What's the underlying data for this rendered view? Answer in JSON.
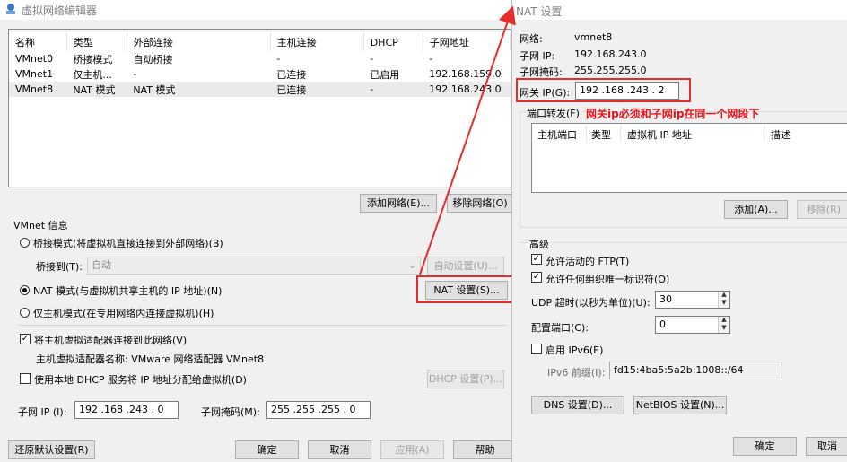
{
  "left_window": {
    "title": "虚拟网络编辑器",
    "table": {
      "columns": [
        "名称",
        "类型",
        "外部连接",
        "主机连接",
        "DHCP",
        "子网地址"
      ],
      "rows": [
        [
          "VMnet0",
          "桥接模式",
          "自动桥接",
          "-",
          "-",
          "-"
        ],
        [
          "VMnet1",
          "仅主机...",
          "-",
          "已连接",
          "已启用",
          "192.168.159.0"
        ],
        [
          "VMnet8",
          "NAT 模式",
          "NAT 模式",
          "已连接",
          "-",
          "192.168.243.0"
        ]
      ]
    },
    "add_network": "添加网络(E)...",
    "remove_network": "移除网络(O)",
    "vmnet_info": "VMnet 信息",
    "bridge_mode": "桥接模式(将虚拟机直接连接到外部网络)(B)",
    "bridge_to_label": "桥接到(T):",
    "bridge_to_value": "自动",
    "auto_settings": "自动设置(U)...",
    "nat_mode": "NAT 模式(与虚拟机共享主机的 IP 地址)(N)",
    "nat_settings": "NAT 设置(S)...",
    "host_only": "仅主机模式(在专用网络内连接虚拟机)(H)",
    "connect_adapter": "将主机虚拟适配器连接到此网络(V)",
    "adapter_name": "主机虚拟适配器名称: VMware 网络适配器 VMnet8",
    "use_dhcp": "使用本地 DHCP 服务将 IP 地址分配给虚拟机(D)",
    "dhcp_settings": "DHCP 设置(P)...",
    "subnet_ip_label": "子网 IP (I):",
    "subnet_ip_value": "192 .168 .243 .  0",
    "subnet_mask_label": "子网掩码(M):",
    "subnet_mask_value": "255 .255 .255 .  0",
    "restore_defaults": "还原默认设置(R)",
    "ok": "确定",
    "cancel": "取消",
    "apply": "应用(A)",
    "help": "帮助"
  },
  "nat_window": {
    "title": "NAT 设置",
    "network_label": "网络:",
    "network_value": "vmnet8",
    "subnet_ip_label": "子网 IP:",
    "subnet_ip_value": "192.168.243.0",
    "subnet_mask_label": "子网掩码:",
    "subnet_mask_value": "255.255.255.0",
    "gateway_label": "网关 IP(G):",
    "gateway_value": "192 .168 .243 .  2",
    "port_forward_label": "端口转发(F)",
    "annotation": "网关ip必须和子网ip在同一个网段下",
    "pf_columns": [
      "主机端口",
      "类型",
      "虚拟机 IP 地址",
      "描述"
    ],
    "add": "添加(A)...",
    "remove": "移除(R)",
    "advanced": "高级",
    "allow_ftp": "允许活动的 FTP(T)",
    "allow_oui": "允许任何组织唯一标识符(O)",
    "udp_timeout_label": "UDP 超时(以秒为单位)(U):",
    "udp_timeout_value": "30",
    "config_port_label": "配置端口(C):",
    "config_port_value": "0",
    "enable_ipv6": "启用 IPv6(E)",
    "ipv6_prefix_label": "IPv6 前缀(I):",
    "ipv6_prefix_value": "fd15:4ba5:5a2b:1008::/64",
    "dns_settings": "DNS 设置(D)...",
    "netbios_settings": "NetBIOS 设置(N)...",
    "ok": "确定",
    "cancel": "取消"
  },
  "colors": {
    "annotation_red": "#e52d2d",
    "window_bg": "#f0f0f0"
  }
}
